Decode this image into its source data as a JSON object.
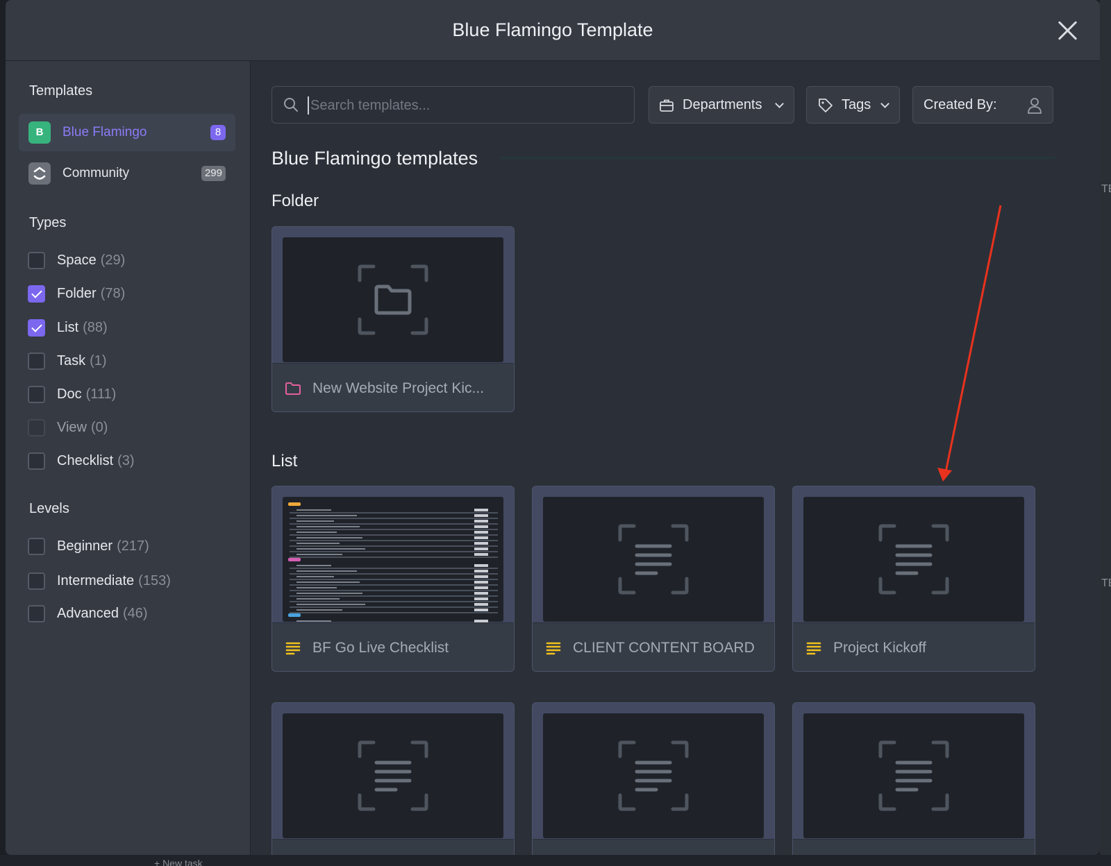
{
  "modal": {
    "title": "Blue Flamingo Template"
  },
  "sidebar": {
    "templates_heading": "Templates",
    "sources": [
      {
        "label": "Blue Flamingo",
        "icon_letter": "B",
        "badge": "8",
        "active": true
      },
      {
        "label": "Community",
        "icon": "clickup-logo-icon",
        "badge": "299",
        "active": false
      }
    ],
    "types_heading": "Types",
    "types": [
      {
        "label": "Space",
        "count": "(29)",
        "checked": false
      },
      {
        "label": "Folder",
        "count": "(78)",
        "checked": true
      },
      {
        "label": "List",
        "count": "(88)",
        "checked": true
      },
      {
        "label": "Task",
        "count": "(1)",
        "checked": false
      },
      {
        "label": "Doc",
        "count": "(111)",
        "checked": false
      },
      {
        "label": "View",
        "count": "(0)",
        "checked": false,
        "disabled": true
      },
      {
        "label": "Checklist",
        "count": "(3)",
        "checked": false
      }
    ],
    "levels_heading": "Levels",
    "levels": [
      {
        "label": "Beginner",
        "count": "(217)",
        "checked": false
      },
      {
        "label": "Intermediate",
        "count": "(153)",
        "checked": false
      },
      {
        "label": "Advanced",
        "count": "(46)",
        "checked": false
      }
    ]
  },
  "toolbar": {
    "search_placeholder": "Search templates...",
    "departments_label": "Departments",
    "tags_label": "Tags",
    "created_by_label": "Created By:"
  },
  "content": {
    "section_title": "Blue Flamingo templates",
    "folder_group": {
      "title": "Folder",
      "cards": [
        {
          "name": "New Website Project Kic...",
          "icon": "folder-icon"
        }
      ]
    },
    "list_group": {
      "title": "List",
      "cards": [
        {
          "name": "BF Go Live Checklist",
          "icon": "list-icon",
          "thumb": "preview"
        },
        {
          "name": "CLIENT CONTENT BOARD",
          "icon": "list-icon",
          "thumb": "placeholder"
        },
        {
          "name": "Project Kickoff",
          "icon": "list-icon",
          "thumb": "placeholder"
        },
        {
          "name": "",
          "icon": "list-icon",
          "thumb": "placeholder"
        },
        {
          "name": "",
          "icon": "list-icon",
          "thumb": "placeholder"
        },
        {
          "name": "",
          "icon": "list-icon",
          "thumb": "placeholder"
        }
      ]
    }
  },
  "background": {
    "strip_texts": [
      "TE",
      "TE"
    ],
    "new_task_label": "+ New task"
  },
  "colors": {
    "accent": "#7b68ee",
    "source_green": "#37b37e",
    "folder_pink": "#e5609e",
    "list_yellow": "#f2c21b",
    "annotation_red": "#e8321e"
  }
}
